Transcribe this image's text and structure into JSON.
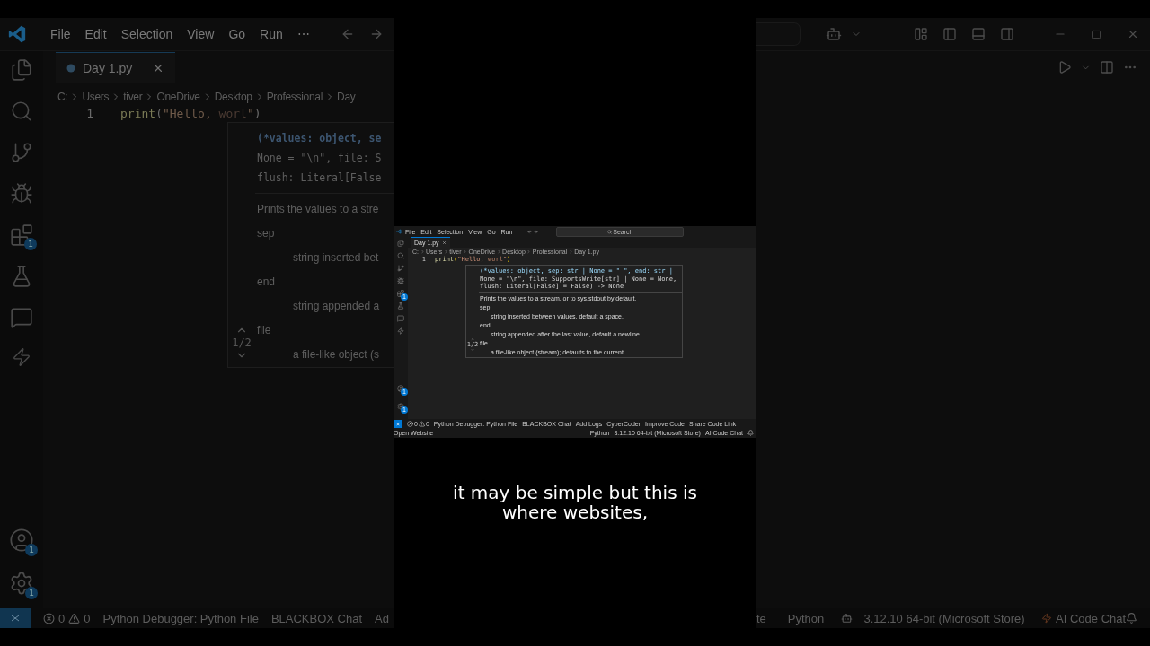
{
  "left_view": {
    "menu": [
      "File",
      "Edit",
      "Selection",
      "View",
      "Go",
      "Run",
      "⋯"
    ],
    "badges": {
      "extensions": "1",
      "accounts": "1",
      "settings": "1"
    },
    "tab": {
      "label": "Day 1.py",
      "selected": true
    },
    "breadcrumb": [
      "C:",
      "Users",
      "tiver",
      "OneDrive",
      "Desktop",
      "Professional",
      "Day"
    ],
    "line_number": "1",
    "code": [
      {
        "text": "print",
        "kind": "function"
      },
      {
        "text": "(",
        "kind": "bracket"
      },
      {
        "text": "\"Hello, ",
        "kind": "string"
      },
      {
        "text": "worl",
        "kind": "dim"
      },
      {
        "text": "\"",
        "kind": "string"
      },
      {
        "text": ")",
        "kind": "bracket"
      }
    ],
    "hover": {
      "signature": [
        "(*values: object, se",
        "None = \"\\n\", file: S",
        "flush: Literal[False"
      ],
      "doc": [
        {
          "kind": "text",
          "text": "Prints the values to a stre"
        },
        {
          "kind": "param",
          "text": "sep"
        },
        {
          "kind": "desc",
          "text": "string inserted bet"
        },
        {
          "kind": "param",
          "text": "end"
        },
        {
          "kind": "desc",
          "text": "string appended a"
        },
        {
          "kind": "param",
          "text": "file"
        },
        {
          "kind": "desc",
          "text": "a file-like object (s"
        }
      ],
      "counter": "1/2"
    },
    "status": {
      "errors": "0",
      "warnings": "0",
      "items": [
        "Python Debugger: Python File",
        "BLACKBOX Chat",
        "Ad"
      ]
    }
  },
  "preview_window": {
    "menu": [
      "File",
      "Edit",
      "Selection",
      "View",
      "Go",
      "Run",
      "⋯"
    ],
    "search": "Search",
    "badges": {
      "extensions": "1",
      "accounts": "1",
      "settings": "1"
    },
    "tab": {
      "label": "Day 1.py",
      "selected": true
    },
    "breadcrumb": [
      "C:",
      "Users",
      "tiver",
      "OneDrive",
      "Desktop",
      "Professional",
      "Day 1.py"
    ],
    "line_number": "1",
    "code": [
      {
        "text": "print",
        "kind": "function"
      },
      {
        "text": "(",
        "kind": "bracket"
      },
      {
        "text": "\"Hello, ",
        "kind": "string"
      },
      {
        "text": "worl",
        "kind": "dim"
      },
      {
        "text": "\"",
        "kind": "string"
      },
      {
        "text": ")",
        "kind": "bracket"
      }
    ],
    "hover": {
      "signature": [
        "(*values: object, sep: str | None = \" \", end: str |",
        "None = \"\\n\", file: SupportsWrite[str] | None = None,",
        "flush: Literal[False] = False) -> None"
      ],
      "doc": [
        {
          "kind": "text",
          "text": "Prints the values to a stream, or to sys.stdout by default."
        },
        {
          "kind": "param",
          "text": "sep"
        },
        {
          "kind": "desc",
          "text": "string inserted between values, default a space."
        },
        {
          "kind": "param",
          "text": "end"
        },
        {
          "kind": "desc",
          "text": "string appended after the last value, default a newline."
        },
        {
          "kind": "param",
          "text": "file"
        },
        {
          "kind": "desc",
          "text": "a file-like object (stream); defaults to the current"
        }
      ],
      "counter": "1/2"
    },
    "status": {
      "errors": "0",
      "warnings": "0",
      "items": [
        "Python Debugger: Python File",
        "BLACKBOX Chat",
        "Add Logs",
        "CyberCoder",
        "Improve Code",
        "Share Code Link",
        "Open Website"
      ],
      "right_items": [
        "Python",
        "3.12.10 64-bit (Microsoft Store)",
        "AI Code Chat"
      ]
    }
  },
  "caption_lines": [
    "it may be simple but this is",
    "where websites,"
  ],
  "right_view": {
    "status": [
      "te",
      "Python",
      "3.12.10 64-bit (Microsoft Store)",
      "AI Code Chat"
    ]
  }
}
